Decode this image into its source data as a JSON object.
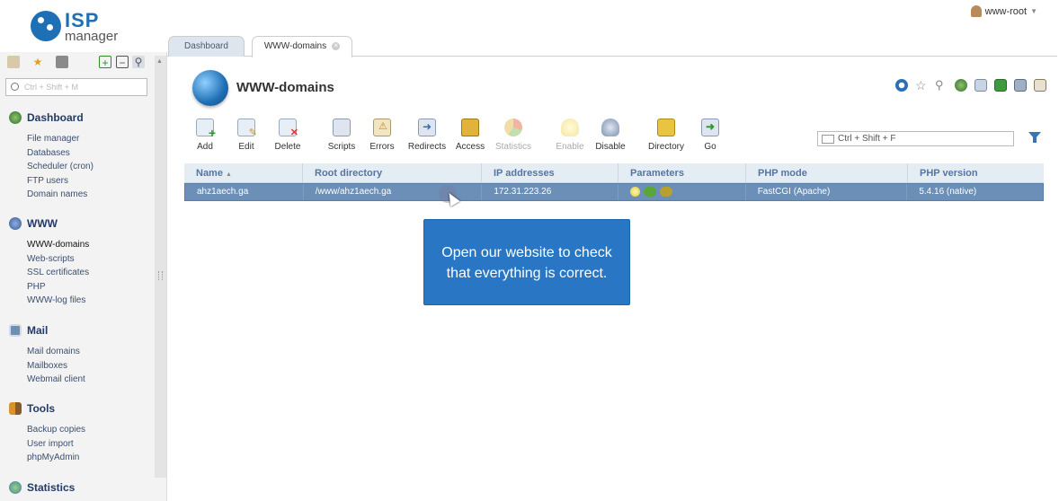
{
  "app": {
    "logo_top": "ISP",
    "logo_bottom": "manager",
    "user_name": "www-root"
  },
  "sidebar": {
    "search_placeholder": "Ctrl + Shift + M",
    "groups": [
      {
        "title": "Dashboard",
        "items": [
          "File manager",
          "Databases",
          "Scheduler (cron)",
          "FTP users",
          "Domain names"
        ]
      },
      {
        "title": "WWW",
        "items": [
          "WWW-domains",
          "Web-scripts",
          "SSL certificates",
          "PHP",
          "WWW-log files"
        ]
      },
      {
        "title": "Mail",
        "items": [
          "Mail domains",
          "Mailboxes",
          "Webmail client"
        ]
      },
      {
        "title": "Tools",
        "items": [
          "Backup copies",
          "User import",
          "phpMyAdmin"
        ]
      },
      {
        "title": "Statistics",
        "items": []
      }
    ]
  },
  "tabs": [
    {
      "label": "Dashboard"
    },
    {
      "label": "WWW-domains"
    }
  ],
  "main": {
    "title": "WWW-domains",
    "filter_placeholder": "Ctrl + Shift + F",
    "toolbar": [
      {
        "label": "Add"
      },
      {
        "label": "Edit"
      },
      {
        "label": "Delete"
      },
      {
        "label": "Scripts"
      },
      {
        "label": "Errors"
      },
      {
        "label": "Redirects"
      },
      {
        "label": "Access"
      },
      {
        "label": "Statistics"
      },
      {
        "label": "Enable"
      },
      {
        "label": "Disable"
      },
      {
        "label": "Directory"
      },
      {
        "label": "Go"
      }
    ],
    "table": {
      "columns": [
        "Name",
        "Root directory",
        "IP addresses",
        "Parameters",
        "PHP mode",
        "PHP version"
      ],
      "rows": [
        [
          "ahz1aech.ga",
          "/www/ahz1aech.ga",
          "172.31.223.26",
          "",
          "FastCGI (Apache)",
          "5.4.16 (native)"
        ]
      ],
      "row_param_icons": [
        "lightbulb-icon",
        "php-icon",
        "ssi-icon"
      ]
    }
  },
  "callout": {
    "line1": "Open our website to check",
    "line2": "that everything is correct."
  },
  "colors": {
    "brand": "#1f6fb5",
    "selected_row": "#6b8fb6",
    "callout": "#2876c4"
  }
}
